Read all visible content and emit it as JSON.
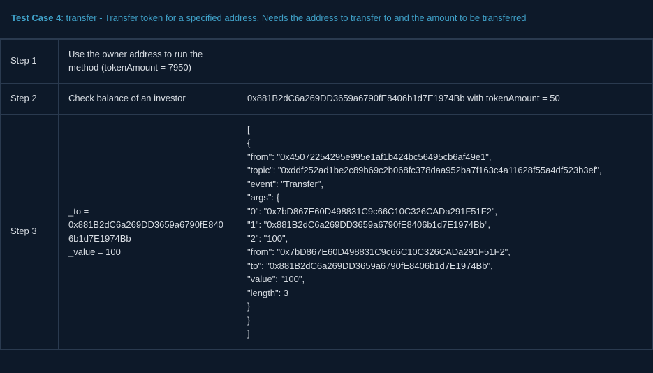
{
  "header": {
    "title": "Test Case 4",
    "desc": ": transfer - Transfer token for a specified address. Needs the address to transfer to and the amount to be transferred"
  },
  "rows": {
    "r1": {
      "step": "Step 1",
      "action": "Use the owner address to run the method (tokenAmount = 7950)",
      "detail": ""
    },
    "r2": {
      "step": "Step 2",
      "action": "Check balance of an investor",
      "detail": "0x881B2dC6a269DD3659a6790fE8406b1d7E1974Bb with tokenAmount = 50"
    },
    "r3": {
      "step": "Step 3",
      "action": "_to = 0x881B2dC6a269DD3659a6790fE8406b1d7E1974Bb\n_value = 100",
      "detail": "[\n{\n\"from\": \"0x45072254295e995e1af1b424bc56495cb6af49e1\",\n\"topic\": \"0xddf252ad1be2c89b69c2b068fc378daa952ba7f163c4a11628f55a4df523b3ef\",\n\"event\": \"Transfer\",\n\"args\": {\n\"0\": \"0x7bD867E60D498831C9c66C10C326CADa291F51F2\",\n\"1\": \"0x881B2dC6a269DD3659a6790fE8406b1d7E1974Bb\",\n\"2\": \"100\",\n\"from\": \"0x7bD867E60D498831C9c66C10C326CADa291F51F2\",\n\"to\": \"0x881B2dC6a269DD3659a6790fE8406b1d7E1974Bb\",\n\"value\": \"100\",\n\"length\": 3\n}\n}\n]"
    }
  }
}
